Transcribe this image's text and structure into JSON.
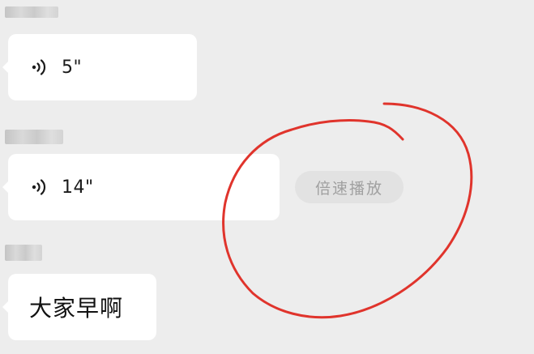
{
  "messages": [
    {
      "type": "voice",
      "duration": "5\"",
      "icon": "voice-wave-icon"
    },
    {
      "type": "voice",
      "duration": "14\"",
      "icon": "voice-wave-icon"
    },
    {
      "type": "text",
      "text": "大家早啊"
    }
  ],
  "speed_playback": {
    "label": "倍速播放"
  },
  "colors": {
    "background": "#ededed",
    "bubble": "#ffffff",
    "pill": "#e2e2e2",
    "pill_text": "#a0a0a0",
    "annotation": "#e0342c"
  }
}
